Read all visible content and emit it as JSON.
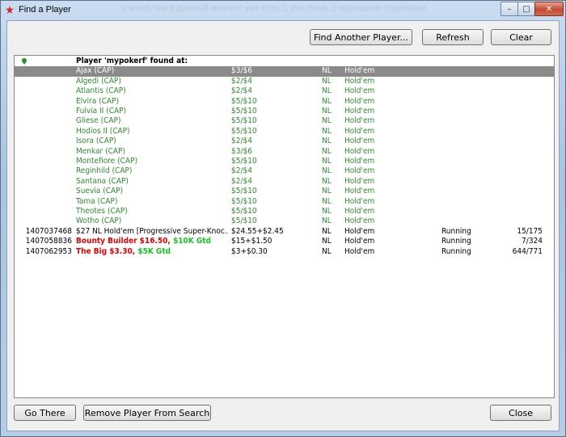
{
  "window": {
    "title": "Find a Player",
    "background_text": "у меня там в данный момент уже есть 1 участник, с хорошими покупками",
    "controls": {
      "minimize": "–",
      "maximize": "□",
      "close": "✕"
    }
  },
  "toolbar": {
    "find_another_label": "Find Another Player...",
    "refresh_label": "Refresh",
    "clear_label": "Clear"
  },
  "list": {
    "header_text": "Player 'mypokerf' found at:",
    "selected_index": 0,
    "rows": [
      {
        "id": "",
        "name": "Ajax (CAP)",
        "stakes": "$3/$6",
        "limit": "NL",
        "game": "Hold'em",
        "status": "",
        "count": ""
      },
      {
        "id": "",
        "name": "Algedi (CAP)",
        "stakes": "$2/$4",
        "limit": "NL",
        "game": "Hold'em",
        "status": "",
        "count": ""
      },
      {
        "id": "",
        "name": "Atlantis (CAP)",
        "stakes": "$2/$4",
        "limit": "NL",
        "game": "Hold'em",
        "status": "",
        "count": ""
      },
      {
        "id": "",
        "name": "Elvira (CAP)",
        "stakes": "$5/$10",
        "limit": "NL",
        "game": "Hold'em",
        "status": "",
        "count": ""
      },
      {
        "id": "",
        "name": "Fulvia II (CAP)",
        "stakes": "$5/$10",
        "limit": "NL",
        "game": "Hold'em",
        "status": "",
        "count": ""
      },
      {
        "id": "",
        "name": "Gliese (CAP)",
        "stakes": "$5/$10",
        "limit": "NL",
        "game": "Hold'em",
        "status": "",
        "count": ""
      },
      {
        "id": "",
        "name": "Hodios II (CAP)",
        "stakes": "$5/$10",
        "limit": "NL",
        "game": "Hold'em",
        "status": "",
        "count": ""
      },
      {
        "id": "",
        "name": "Isora (CAP)",
        "stakes": "$2/$4",
        "limit": "NL",
        "game": "Hold'em",
        "status": "",
        "count": ""
      },
      {
        "id": "",
        "name": "Menkar (CAP)",
        "stakes": "$3/$6",
        "limit": "NL",
        "game": "Hold'em",
        "status": "",
        "count": ""
      },
      {
        "id": "",
        "name": "Montefiore (CAP)",
        "stakes": "$5/$10",
        "limit": "NL",
        "game": "Hold'em",
        "status": "",
        "count": ""
      },
      {
        "id": "",
        "name": "Reginhild (CAP)",
        "stakes": "$2/$4",
        "limit": "NL",
        "game": "Hold'em",
        "status": "",
        "count": ""
      },
      {
        "id": "",
        "name": "Santana (CAP)",
        "stakes": "$2/$4",
        "limit": "NL",
        "game": "Hold'em",
        "status": "",
        "count": ""
      },
      {
        "id": "",
        "name": "Suevia (CAP)",
        "stakes": "$5/$10",
        "limit": "NL",
        "game": "Hold'em",
        "status": "",
        "count": ""
      },
      {
        "id": "",
        "name": "Tama (CAP)",
        "stakes": "$5/$10",
        "limit": "NL",
        "game": "Hold'em",
        "status": "",
        "count": ""
      },
      {
        "id": "",
        "name": "Theotes (CAP)",
        "stakes": "$5/$10",
        "limit": "NL",
        "game": "Hold'em",
        "status": "",
        "count": ""
      },
      {
        "id": "",
        "name": "Wotho (CAP)",
        "stakes": "$5/$10",
        "limit": "NL",
        "game": "Hold'em",
        "status": "",
        "count": ""
      },
      {
        "id": "1407037468",
        "name": "$27 NL Hold'em [Progressive Super-Knoc...",
        "stakes": "$24.55+$2.45",
        "limit": "NL",
        "game": "Hold'em",
        "status": "Running",
        "count": "15/175"
      },
      {
        "id": "1407058836",
        "name_parts": [
          {
            "text": "Bounty Builder $16.50",
            "color": "red"
          },
          {
            "text": ", ",
            "color": "red"
          },
          {
            "text": "$10K Gtd",
            "color": "lime"
          }
        ],
        "stakes": "$15+$1.50",
        "limit": "NL",
        "game": "Hold'em",
        "status": "Running",
        "count": "7/324"
      },
      {
        "id": "1407062953",
        "name_parts": [
          {
            "text": "The Big $3.30",
            "color": "red"
          },
          {
            "text": ", ",
            "color": "red"
          },
          {
            "text": "$5K Gtd",
            "color": "lime"
          }
        ],
        "stakes": "$3+$0.30",
        "limit": "NL",
        "game": "Hold'em",
        "status": "Running",
        "count": "644/771"
      }
    ]
  },
  "footer": {
    "go_there_label": "Go There",
    "remove_label": "Remove Player From Search",
    "close_label": "Close"
  },
  "colors": {
    "cash_table_text": "#2e8b2e",
    "tournament_text": "#000000",
    "tournament_name_red": "#e00000",
    "tournament_gtd_green": "#14c31e",
    "selected_row_bg": "#8a8a8a"
  }
}
